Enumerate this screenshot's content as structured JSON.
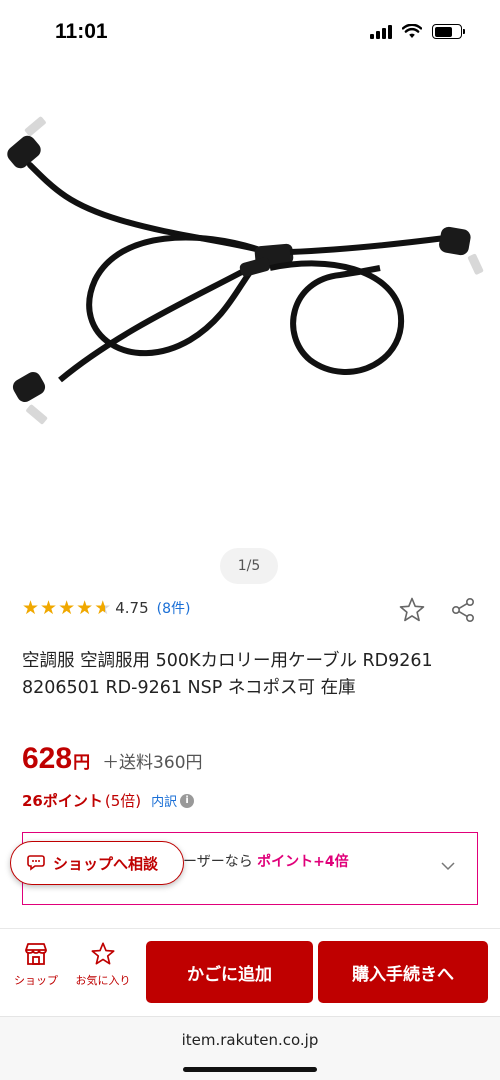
{
  "status": {
    "time": "11:01"
  },
  "gallery": {
    "pager": "1/5"
  },
  "rating": {
    "value": "4.75",
    "count": "(8件)",
    "stars": 4.75
  },
  "product": {
    "title": "空調服 空調服用 500Kカロリー用ケーブル RD9261 8206501 RD-9261 NSP ネコポス可 在庫"
  },
  "price": {
    "amount": "628",
    "yen": "円",
    "shipping": "＋送料360円"
  },
  "points": {
    "label": "26ポイント",
    "mult": "(5倍)",
    "breakdown": "内訳"
  },
  "member": {
    "text_prefix": "ーザーなら ",
    "text_highlight": "ポイント+4倍",
    "sub": ""
  },
  "consult": {
    "label": "ショップへ相談"
  },
  "bottom": {
    "shop_label": "ショップ",
    "fav_label": "お気に入り",
    "cart_label": "かごに追加",
    "buy_label": "購入手続きへ"
  },
  "browser": {
    "url": "item.rakuten.co.jp"
  },
  "colors": {
    "brand": "#bf0000",
    "star": "#f0a800",
    "link": "#1a6fd6",
    "pink": "#e0007a"
  }
}
